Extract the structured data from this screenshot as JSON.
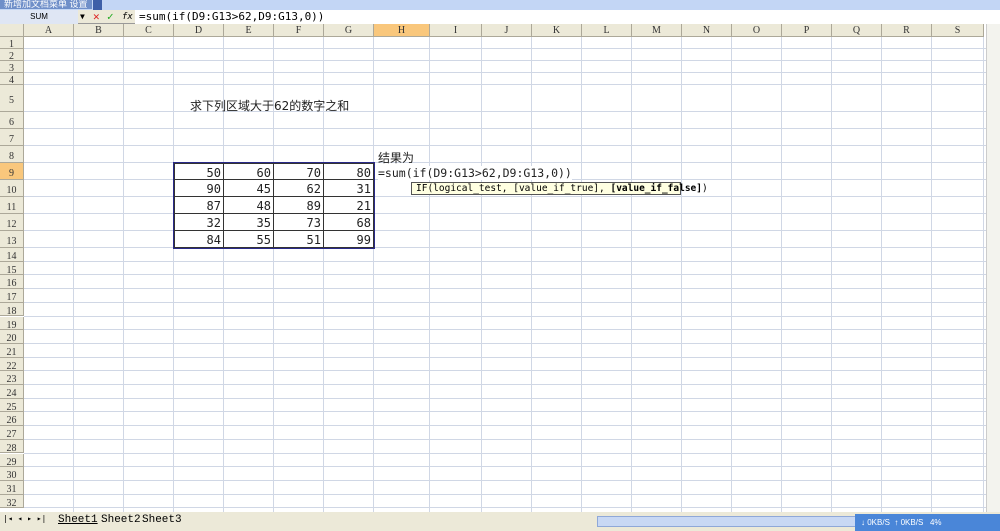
{
  "menu_label": "新增加文档菜单 设置",
  "name_box": "SUM",
  "formula": "=sum(if(D9:G13>62,D9:G13,0))",
  "columns": [
    "A",
    "B",
    "C",
    "D",
    "E",
    "F",
    "G",
    "H",
    "I",
    "J",
    "K",
    "L",
    "M",
    "N",
    "O",
    "P",
    "Q",
    "R",
    "S"
  ],
  "rows": [
    "1",
    "2",
    "3",
    "4",
    "5",
    "6",
    "7",
    "8",
    "9",
    "10",
    "11",
    "12",
    "13",
    "14",
    "15",
    "16",
    "17",
    "18",
    "19",
    "20",
    "21",
    "22",
    "23",
    "24",
    "25",
    "26",
    "27",
    "28",
    "29",
    "30",
    "31",
    "32"
  ],
  "selected_col": "H",
  "selected_row": "9",
  "title_text": "求下列区域大于62的数字之和",
  "result_label": "结果为",
  "cell_formula": "=sum(if(D9:G13>62,D9:G13,0))",
  "table": [
    [
      50,
      60,
      70,
      80
    ],
    [
      90,
      45,
      62,
      31
    ],
    [
      87,
      48,
      89,
      21
    ],
    [
      32,
      35,
      73,
      68
    ],
    [
      84,
      55,
      51,
      99
    ]
  ],
  "tooltip": {
    "pre": "IF(logical_test, [value_if_true], ",
    "bold": "[value_if_false]",
    "post": ")"
  },
  "sheets": [
    "Sheet1",
    "Sheet2",
    "Sheet3"
  ],
  "status": {
    "down": "0KB/S",
    "up": "0KB/S",
    "cpu": "4%"
  }
}
